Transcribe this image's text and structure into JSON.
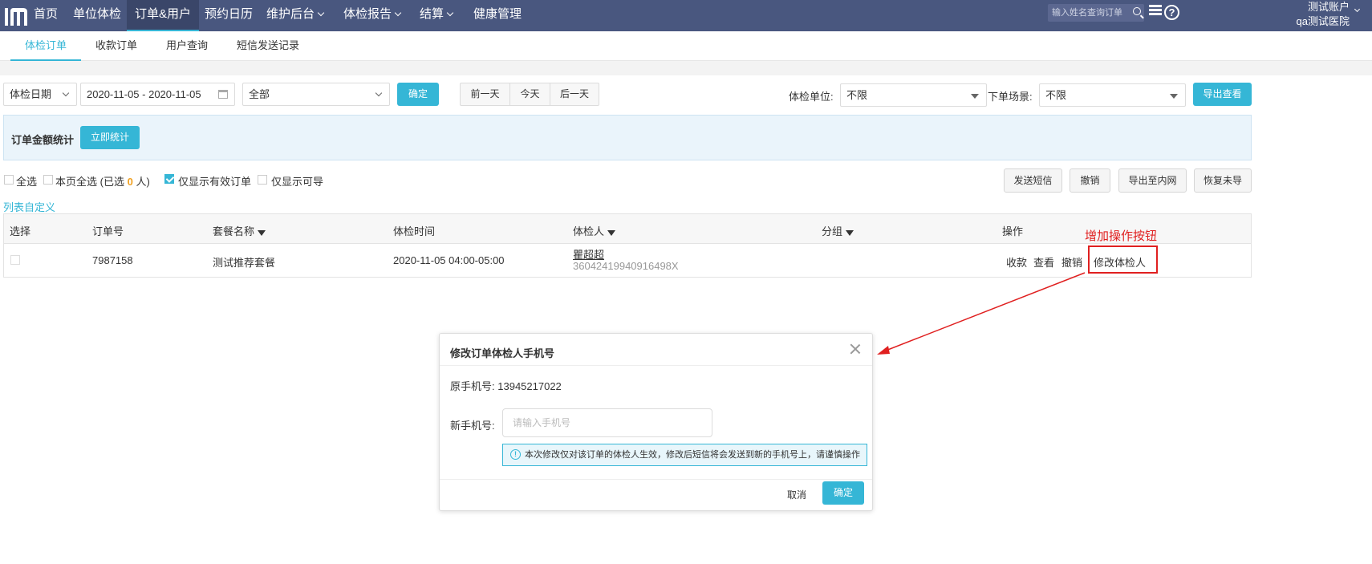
{
  "topnav": {
    "items": [
      {
        "label": "首页"
      },
      {
        "label": "单位体检"
      },
      {
        "label": "订单&用户"
      },
      {
        "label": "预约日历"
      },
      {
        "label": "维护后台"
      },
      {
        "label": "体检报告"
      },
      {
        "label": "结算"
      },
      {
        "label": "健康管理"
      }
    ],
    "search_placeholder": "输入姓名查询订单",
    "account_name": "测试账户",
    "hospital_name": "qa测试医院"
  },
  "subtabs": [
    {
      "label": "体检订单"
    },
    {
      "label": "收款订单"
    },
    {
      "label": "用户查询"
    },
    {
      "label": "短信发送记录"
    }
  ],
  "filters": {
    "date_type": "体检日期",
    "date_range": "2020-11-05 - 2020-11-05",
    "status": "全部",
    "confirm": "确定",
    "day_buttons": [
      "前一天",
      "今天",
      "后一天"
    ],
    "unit_label": "体检单位:",
    "unit_value": "不限",
    "scene_label": "下单场景:",
    "scene_value": "不限",
    "export_view": "导出查看"
  },
  "stats": {
    "label": "订单金额统计",
    "button": "立即统计"
  },
  "selection": {
    "select_all": "全选",
    "page_select_all": "本页全选",
    "selected_prefix": "(已选",
    "selected_count": "0",
    "selected_suffix": "人)",
    "only_valid": "仅显示有效订单",
    "only_refundable": "仅显示可导",
    "actions": [
      "发送短信",
      "撤销",
      "导出至内网",
      "恢复未导"
    ]
  },
  "column_custom": "列表自定义",
  "table": {
    "headers": [
      "选择",
      "订单号",
      "套餐名称",
      "体检时间",
      "体检人",
      "分组",
      "操作"
    ],
    "rows": [
      {
        "order_no": "7987158",
        "package": "测试推荐套餐",
        "time": "2020-11-05 04:00-05:00",
        "person_name": "瞿超超",
        "person_id": "36042419940916498X",
        "ops": [
          "收款",
          "查看",
          "撤销",
          "修改体检人"
        ]
      }
    ]
  },
  "annotation": "增加操作按钮",
  "modal": {
    "title": "修改订单体检人手机号",
    "orig_label": "原手机号:",
    "orig_value": "13945217022",
    "new_label": "新手机号:",
    "new_placeholder": "请输入手机号",
    "notice": "本次修改仅对该订单的体检人生效，修改后短信将会发送到新的手机号上，请谨慎操作",
    "cancel": "取消",
    "confirm": "确定"
  },
  "colors": {
    "nav_bg": "#49577f",
    "accent": "#35b6d6",
    "annotation_red": "#e02020"
  },
  "icons": [
    "logo-icon",
    "search-icon",
    "list-icon",
    "help-icon",
    "calendar-icon",
    "filter-icon",
    "close-icon",
    "info-icon"
  ]
}
